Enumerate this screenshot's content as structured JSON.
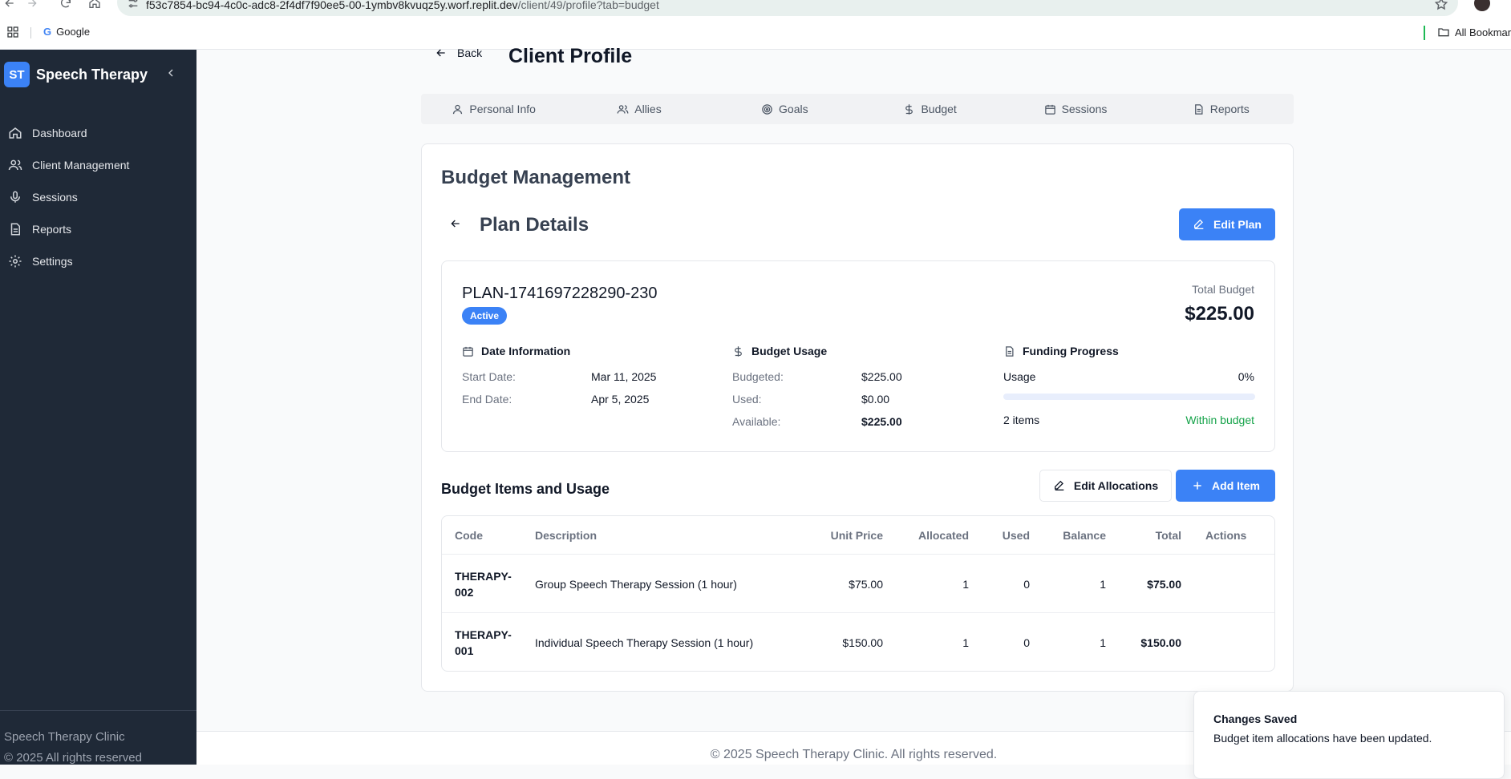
{
  "browser": {
    "url_host": "f53c7854-bc94-4c0c-adc8-2f4df7f90ee5-00-1ymbv8kvuqz5y.worf.replit.dev",
    "url_path": "/client/49/profile?tab=budget",
    "bookmarks": [
      {
        "label": "Google",
        "icon": "google-icon"
      }
    ],
    "all_bookmarks_label": "All Bookmarks"
  },
  "sidebar": {
    "logo_text": "ST",
    "app_name": "Speech Therapy",
    "items": [
      {
        "label": "Dashboard",
        "icon": "home-icon"
      },
      {
        "label": "Client Management",
        "icon": "users-icon"
      },
      {
        "label": "Sessions",
        "icon": "mic-icon"
      },
      {
        "label": "Reports",
        "icon": "file-icon"
      },
      {
        "label": "Settings",
        "icon": "gear-icon"
      }
    ],
    "footer_line1": "Speech Therapy Clinic",
    "footer_line2": "© 2025 All rights reserved"
  },
  "header": {
    "back_label": "Back",
    "title": "Client Profile"
  },
  "tabs": [
    {
      "label": "Personal Info",
      "icon": "user-icon"
    },
    {
      "label": "Allies",
      "icon": "users-icon"
    },
    {
      "label": "Goals",
      "icon": "target-icon"
    },
    {
      "label": "Budget",
      "icon": "dollar-icon"
    },
    {
      "label": "Sessions",
      "icon": "calendar-icon"
    },
    {
      "label": "Reports",
      "icon": "file-icon"
    }
  ],
  "budget": {
    "section_title": "Budget Management",
    "plan_details_title": "Plan Details",
    "edit_plan_label": "Edit Plan",
    "plan": {
      "id": "PLAN-1741697228290-230",
      "status": "Active",
      "total_budget_label": "Total Budget",
      "total_budget": "$225.00",
      "date_info": {
        "title": "Date Information",
        "start_label": "Start Date:",
        "start_value": "Mar 11, 2025",
        "end_label": "End Date:",
        "end_value": "Apr 5, 2025"
      },
      "usage": {
        "title": "Budget Usage",
        "budgeted_label": "Budgeted:",
        "budgeted_value": "$225.00",
        "used_label": "Used:",
        "used_value": "$0.00",
        "available_label": "Available:",
        "available_value": "$225.00"
      },
      "funding": {
        "title": "Funding Progress",
        "usage_label": "Usage",
        "usage_percent": "0%",
        "progress_fraction": 0.0,
        "items_label": "2 items",
        "status_label": "Within budget"
      }
    },
    "items_title": "Budget Items and Usage",
    "edit_allocations_label": "Edit Allocations",
    "add_item_label": "Add Item",
    "table": {
      "headers": [
        "Code",
        "Description",
        "Unit Price",
        "Allocated",
        "Used",
        "Balance",
        "Total",
        "Actions"
      ],
      "rows": [
        {
          "code_line1": "THERAPY-",
          "code_line2": "002",
          "description": "Group Speech Therapy Session (1 hour)",
          "unit_price": "$75.00",
          "allocated": "1",
          "used": "0",
          "balance": "1",
          "total": "$75.00"
        },
        {
          "code_line1": "THERAPY-",
          "code_line2": "001",
          "description": "Individual Speech Therapy Session (1 hour)",
          "unit_price": "$150.00",
          "allocated": "1",
          "used": "0",
          "balance": "1",
          "total": "$150.00"
        }
      ]
    }
  },
  "footer": {
    "text": "© 2025 Speech Therapy Clinic. All rights reserved."
  },
  "toast": {
    "title": "Changes Saved",
    "message": "Budget item allocations have been updated."
  },
  "colors": {
    "accent": "#3b82f6",
    "sidebar_bg": "#1f2937",
    "success": "#16a34a"
  }
}
